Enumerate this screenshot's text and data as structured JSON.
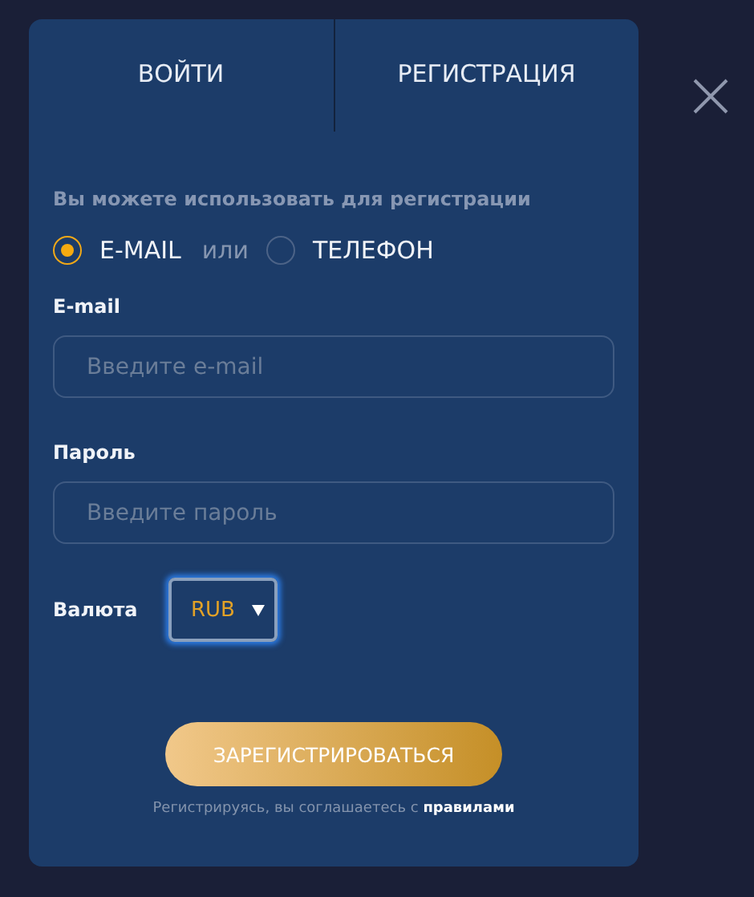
{
  "tabs": [
    {
      "label": "ВОЙТИ"
    },
    {
      "label": "РЕГИСТРАЦИЯ"
    }
  ],
  "hint": "Вы можете использовать для регистрации",
  "methods": [
    {
      "label": "E-MAIL",
      "selected": true
    },
    {
      "label": "ТЕЛЕФОН",
      "selected": false
    }
  ],
  "methods_separator": "или",
  "fields": [
    {
      "label": "E-mail",
      "placeholder": "Введите e-mail"
    },
    {
      "label": "Пароль",
      "placeholder": "Введите пароль"
    }
  ],
  "currency": {
    "label": "Валюта",
    "value": "RUB"
  },
  "submit": "ЗАРЕГИСТРИРОВАТЬСЯ",
  "terms": {
    "text": "Регистрируясь, вы соглашаетесь с",
    "link": "правилами"
  }
}
